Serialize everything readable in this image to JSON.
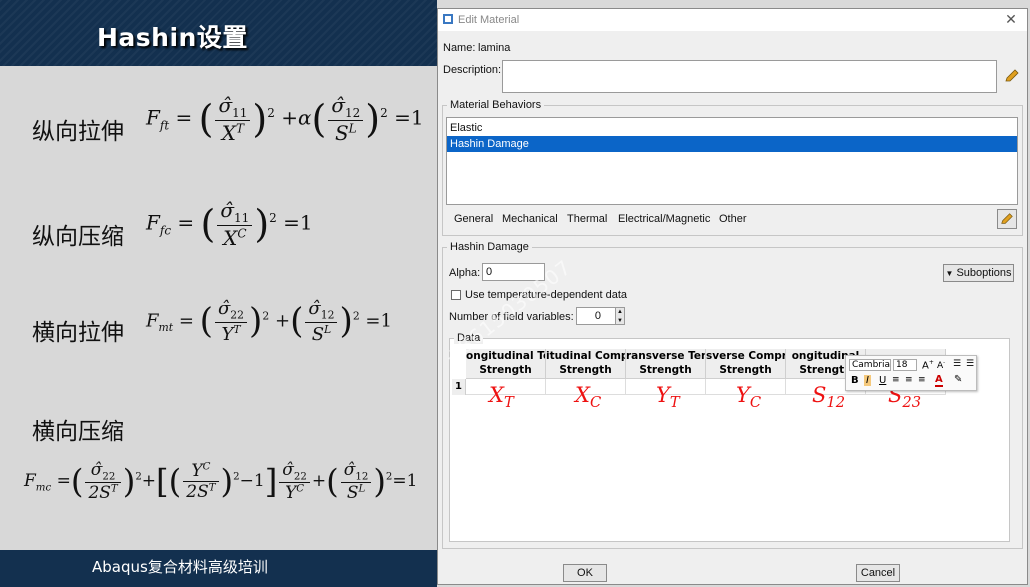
{
  "slide": {
    "title": "Hashin设置",
    "footer": "Abaqus复合材料高级培训",
    "labels": [
      "纵向拉伸",
      "纵向压缩",
      "横向拉伸",
      "横向压缩"
    ]
  },
  "dialog": {
    "title": "Edit Material",
    "name_label": "Name:",
    "name_value": "lamina",
    "description_label": "Description:",
    "behaviors_title": "Material Behaviors",
    "behaviors": [
      "Elastic",
      "Hashin Damage"
    ],
    "selected_behavior": "Hashin Damage",
    "menus": [
      "General",
      "Mechanical",
      "Thermal",
      "Electrical/Magnetic",
      "Other"
    ],
    "hashin_title": "Hashin Damage",
    "alpha_label": "Alpha:",
    "alpha_value": "0",
    "suboptions_label": "Suboptions",
    "temp_label": "Use temperature-dependent data",
    "field_vars_label": "Number of field variables:",
    "field_vars_value": "0",
    "data_title": "Data",
    "columns": [
      {
        "l1": "ongitudinal Tens",
        "l2": "Strength"
      },
      {
        "l1": "itudinal Compre",
        "l2": "Strength"
      },
      {
        "l1": "ransverse Tensil",
        "l2": "Strength"
      },
      {
        "l1": "sverse Compres",
        "l2": "Strength"
      },
      {
        "l1": "ongitudinal",
        "l2": "Strength"
      }
    ],
    "row_index": "1",
    "ok_label": "OK",
    "cancel_label": "Cancel"
  },
  "annotations": [
    {
      "base": "X",
      "sub": "T"
    },
    {
      "base": "X",
      "sub": "C"
    },
    {
      "base": "Y",
      "sub": "T"
    },
    {
      "base": "Y",
      "sub": "C"
    },
    {
      "base": "S",
      "sub": "12"
    },
    {
      "base": "S",
      "sub": "23"
    }
  ],
  "mini_toolbar": {
    "font": "Cambria",
    "size": "18"
  },
  "watermark": "+8615030507"
}
